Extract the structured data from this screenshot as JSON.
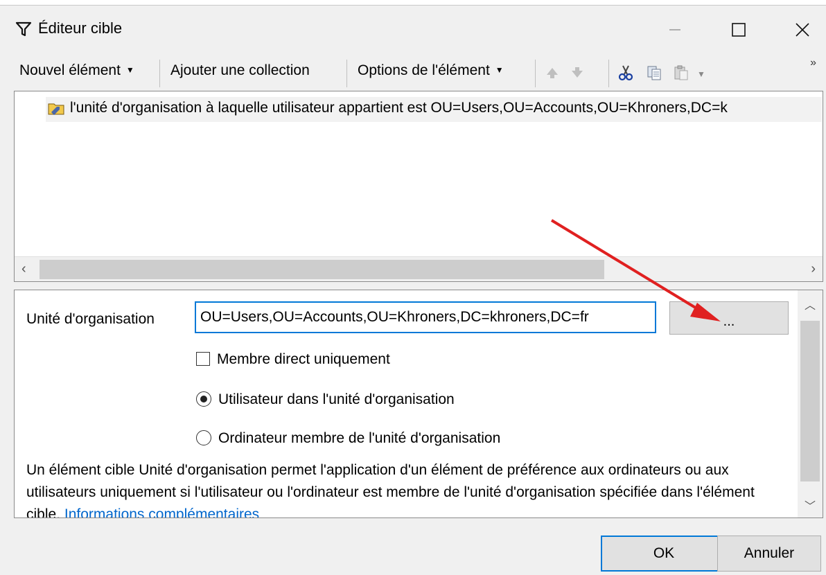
{
  "window": {
    "title": "Éditeur cible"
  },
  "toolbar": {
    "new_item_label": "Nouvel élément",
    "add_collection_label": "Ajouter une collection",
    "item_options_label": "Options de l'élément",
    "overflow_label": "»"
  },
  "list": {
    "items": [
      {
        "label": "l'unité d'organisation à laquelle utilisateur appartient est OU=Users,OU=Accounts,OU=Khroners,DC=k",
        "icon": "ou-item-icon"
      }
    ]
  },
  "properties": {
    "ou_label": "Unité d'organisation",
    "ou_value": "OU=Users,OU=Accounts,OU=Khroners,DC=khroners,DC=fr",
    "browse_label": "...",
    "direct_member_label": "Membre direct uniquement",
    "direct_member_checked": false,
    "user_in_ou_label": "Utilisateur dans l'unité d'organisation",
    "computer_in_ou_label": "Ordinateur membre de l'unité d'organisation",
    "selected_option": "user_in_ou",
    "description": "Un élément cible Unité d'organisation permet l'application d'un élément de préférence aux ordinateurs ou aux utilisateurs uniquement si l'utilisateur ou l'ordinateur est membre de l'unité d'organisation spécifiée dans l'élément cible.",
    "more_info_link": "Informations complémentaires"
  },
  "buttons": {
    "ok_label": "OK",
    "cancel_label": "Annuler"
  },
  "colors": {
    "accent": "#0078d7",
    "annotation_arrow": "#e02020",
    "link": "#0066cc"
  }
}
